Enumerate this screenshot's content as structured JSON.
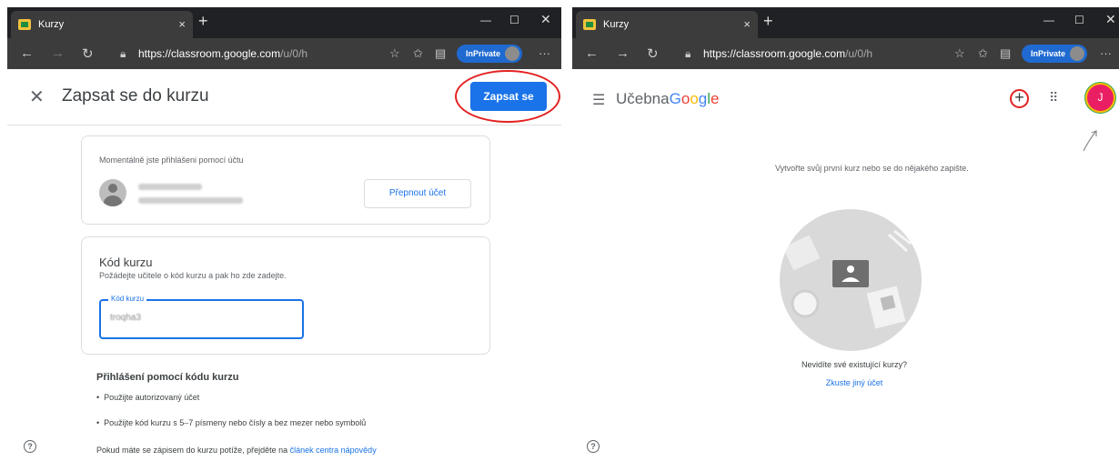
{
  "left": {
    "browser": {
      "tab_title": "Kurzy",
      "tab_close": "×",
      "newtab": "+",
      "url_host": "https://classroom.google.com",
      "url_path": "/u/0/h",
      "inprivate": "InPrivate"
    },
    "header": {
      "close_glyph": "✕",
      "title": "Zapsat se do kurzu",
      "join_button": "Zapsat se"
    },
    "account": {
      "label": "Momentálně jste přihlášeni pomocí účtu",
      "switch_button": "Přepnout účet"
    },
    "code_card": {
      "title": "Kód kurzu",
      "description": "Požádejte učitele o kód kurzu a pak ho zde zadejte.",
      "field_label": "Kód kurzu",
      "field_value": "troqha3"
    },
    "rules": {
      "title": "Přihlášení pomocí kódu kurzu",
      "items": [
        "Použijte autorizovaný účet",
        "Použijte kód kurzu s 5–7 písmeny nebo čísly a bez mezer nebo symbolů"
      ]
    },
    "help": {
      "text": "Pokud máte se zápisem do kurzu potíže, přejděte na ",
      "link": "článek centra nápovědy"
    }
  },
  "right": {
    "browser": {
      "tab_title": "Kurzy",
      "tab_close": "×",
      "newtab": "+",
      "url_host": "https://classroom.google.com",
      "url_path": "/u/0/h",
      "inprivate": "InPrivate"
    },
    "header": {
      "brand_prefix": "Učebna",
      "avatar_letter": "J"
    },
    "hint": "Vytvořte svůj první kurz nebo se do nějakého zapište.",
    "empty_title": "Nevidíte své existující kurzy?",
    "empty_link": "Zkuste jiný účet"
  },
  "colors": {
    "accent": "#1a73e8",
    "annotation": "#e32121",
    "chrome_dark": "#202124"
  },
  "icons": [
    "back-icon",
    "forward-icon",
    "refresh-icon",
    "lock-icon",
    "favorites-icon",
    "collections-icon",
    "help-icon",
    "apps-icon",
    "plus-icon",
    "menu-icon"
  ]
}
